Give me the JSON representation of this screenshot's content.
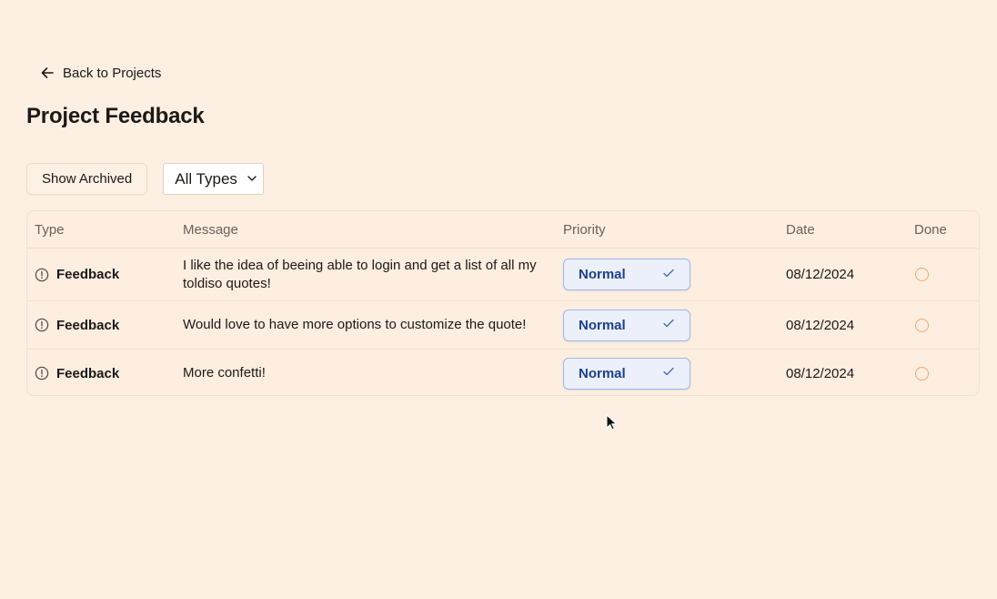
{
  "header": {
    "back_label": "Back to Projects",
    "title": "Project Feedback"
  },
  "toolbar": {
    "show_archived_label": "Show Archived",
    "type_filter": {
      "selected": "All Types"
    }
  },
  "table": {
    "columns": {
      "type": "Type",
      "message": "Message",
      "priority": "Priority",
      "date": "Date",
      "done": "Done"
    },
    "rows": [
      {
        "type": "Feedback",
        "message": "I like the idea of beeing able to login and get a list of all my toldiso quotes!",
        "priority": "Normal",
        "date": "08/12/2024",
        "done": false
      },
      {
        "type": "Feedback",
        "message": "Would love to have more options to customize the quote!",
        "priority": "Normal",
        "date": "08/12/2024",
        "done": false
      },
      {
        "type": "Feedback",
        "message": "More confetti!",
        "priority": "Normal",
        "date": "08/12/2024",
        "done": false
      }
    ]
  },
  "icons": {
    "back": "arrow-left-icon",
    "type": "alert-circle-icon",
    "priority_check": "check-icon",
    "select": "chevron-down-icon",
    "cursor": "mouse-pointer-icon"
  },
  "colors": {
    "background": "#fdf0e2",
    "priority_bg": "#ebf0fb",
    "priority_border": "#9fb6e8",
    "priority_text": "#1d3f8f",
    "done_circle": "#f0a868"
  }
}
